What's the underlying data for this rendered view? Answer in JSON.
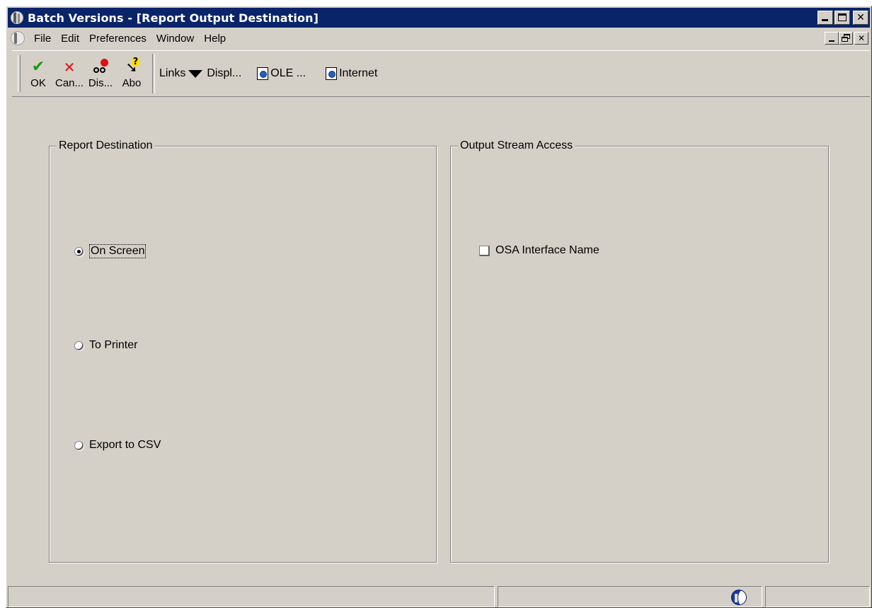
{
  "window": {
    "title": "Batch Versions - [Report Output Destination]"
  },
  "menu": {
    "items": [
      {
        "label": "File"
      },
      {
        "label": "Edit"
      },
      {
        "label": "Preferences"
      },
      {
        "label": "Window"
      },
      {
        "label": "Help"
      }
    ]
  },
  "toolbar": {
    "ok_label": "OK",
    "cancel_label": "Can...",
    "display_label": "Dis...",
    "about_label": "Abo",
    "links_label": "Links",
    "display_menu_label": "Displ...",
    "ole_label": "OLE ...",
    "internet_label": "Internet"
  },
  "report_destination": {
    "legend": "Report Destination",
    "options": [
      {
        "label": "On Screen",
        "selected": true
      },
      {
        "label": "To Printer",
        "selected": false
      },
      {
        "label": "Export to CSV",
        "selected": false
      }
    ]
  },
  "output_stream": {
    "legend": "Output Stream Access",
    "checkbox_label": "OSA Interface Name",
    "checked": false
  },
  "icons": {
    "app": "globe-icon",
    "ok": "check-icon",
    "cancel": "x-icon",
    "display": "glasses-icon",
    "about": "pointer-question-icon",
    "display_menu": "triangle-down-icon",
    "ole": "document-globe-icon",
    "internet": "document-globe-icon",
    "status": "globe-icon"
  },
  "colors": {
    "titlebar": "#0a246a",
    "face": "#d4d0c8",
    "ok": "#1a9a1a",
    "cancel": "#e01010"
  }
}
